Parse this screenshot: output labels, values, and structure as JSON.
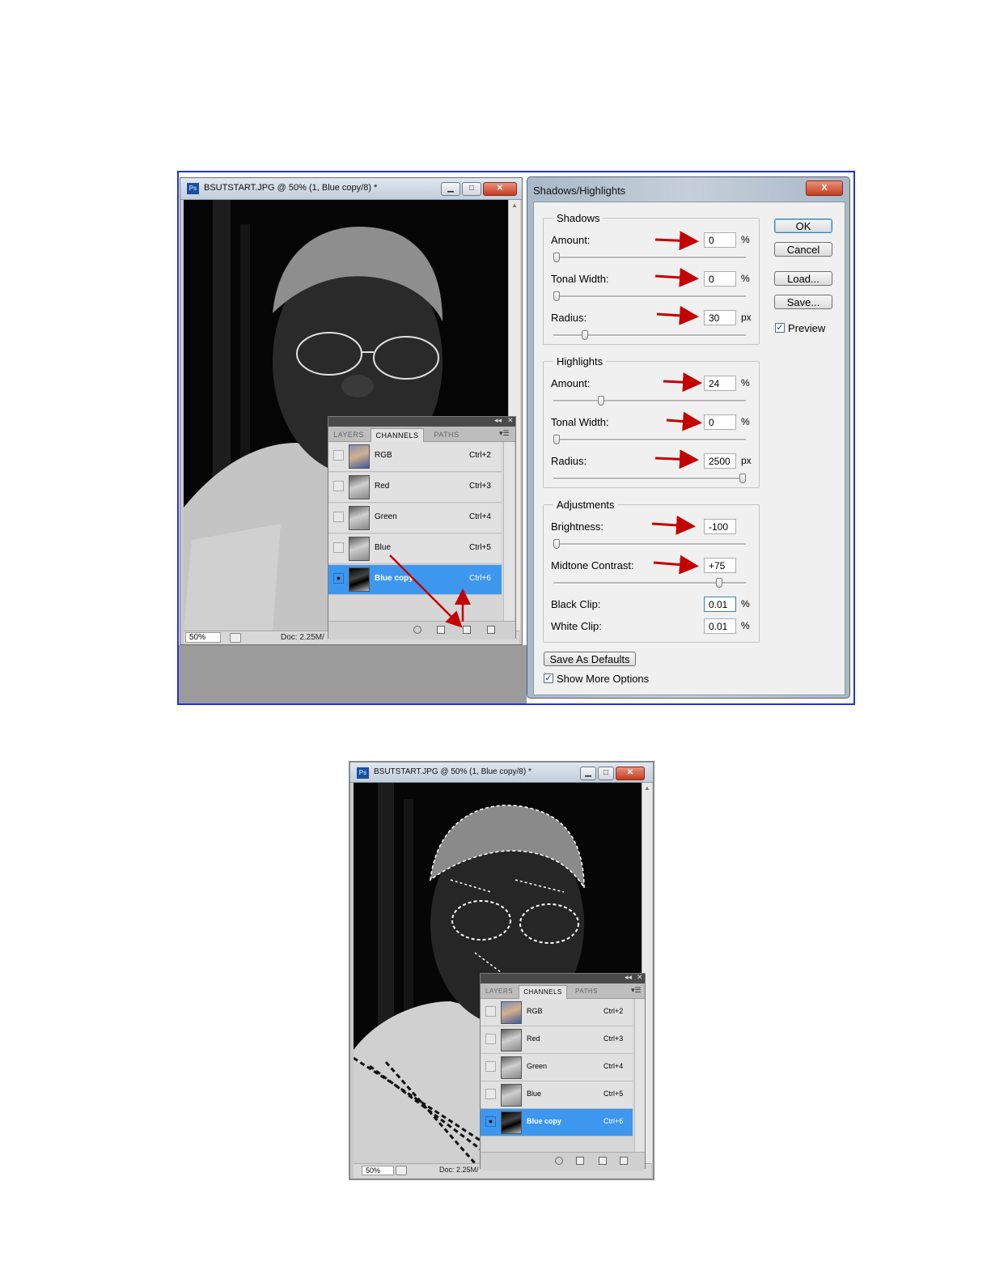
{
  "doc_window": {
    "title": "BSUTSTART.JPG @ 50% (1, Blue copy/8) *",
    "zoom": "50%",
    "doc_info": "Doc: 2.25M/"
  },
  "channels_panel": {
    "tabs": [
      "LAYERS",
      "CHANNELS",
      "PATHS"
    ],
    "active_tab": "CHANNELS",
    "rows": [
      {
        "name": "RGB",
        "shortcut": "Ctrl+2",
        "visible": false,
        "selected": false
      },
      {
        "name": "Red",
        "shortcut": "Ctrl+3",
        "visible": false,
        "selected": false
      },
      {
        "name": "Green",
        "shortcut": "Ctrl+4",
        "visible": false,
        "selected": false
      },
      {
        "name": "Blue",
        "shortcut": "Ctrl+5",
        "visible": false,
        "selected": false
      },
      {
        "name": "Blue copy",
        "shortcut": "Ctrl+6",
        "visible": true,
        "selected": true
      }
    ]
  },
  "dialog": {
    "title": "Shadows/Highlights",
    "close": "X",
    "shadows": {
      "legend": "Shadows",
      "amount_label": "Amount:",
      "amount": "0",
      "amount_unit": "%",
      "amount_level": 0,
      "tonal_label": "Tonal Width:",
      "tonal": "0",
      "tonal_unit": "%",
      "tonal_level": 0,
      "radius_label": "Radius:",
      "radius": "30",
      "radius_unit": "px",
      "radius_level": 0.15
    },
    "highlights": {
      "legend": "Highlights",
      "amount_label": "Amount:",
      "amount": "24",
      "amount_unit": "%",
      "amount_level": 0.24,
      "tonal_label": "Tonal Width:",
      "tonal": "0",
      "tonal_unit": "%",
      "tonal_level": 0,
      "radius_label": "Radius:",
      "radius": "2500",
      "radius_unit": "px",
      "radius_level": 1
    },
    "adjustments": {
      "legend": "Adjustments",
      "brightness_label": "Brightness:",
      "brightness": "-100",
      "brightness_level": 0,
      "contrast_label": "Midtone Contrast:",
      "contrast": "+75",
      "contrast_level": 0.875,
      "black_clip_label": "Black Clip:",
      "black_clip": "0.01",
      "black_clip_unit": "%",
      "white_clip_label": "White Clip:",
      "white_clip": "0.01",
      "white_clip_unit": "%"
    },
    "buttons": {
      "ok": "OK",
      "cancel": "Cancel",
      "load": "Load...",
      "save": "Save..."
    },
    "preview_label": "Preview",
    "preview_checked": true,
    "save_defaults": "Save As Defaults",
    "show_more_label": "Show More Options",
    "show_more_checked": true
  },
  "colors": {
    "selection": "#3d97ee",
    "annotation_arrow": "#c40000",
    "frame": "#1e32e0"
  }
}
